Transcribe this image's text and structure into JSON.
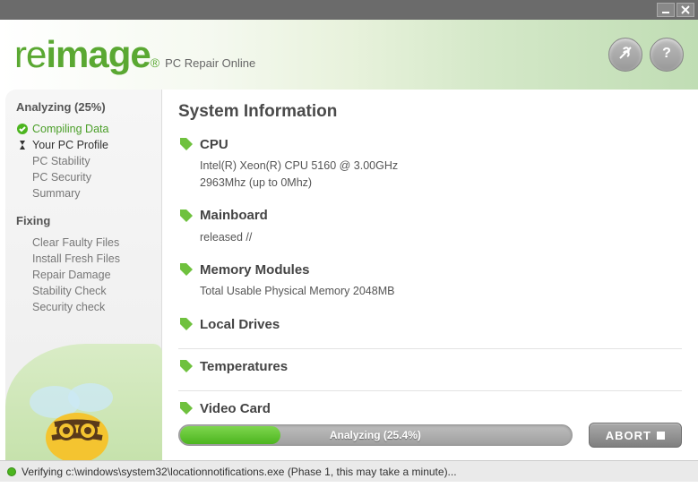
{
  "title_bar": {},
  "header": {
    "logo_prefix": "re",
    "logo_suffix": "image",
    "registered": "®",
    "tagline": "PC Repair Online"
  },
  "sidebar": {
    "analyzing_heading": "Analyzing (25%)",
    "analyzing_items": [
      {
        "label": "Compiling Data",
        "status": "done"
      },
      {
        "label": "Your PC Profile",
        "status": "active"
      },
      {
        "label": "PC Stability",
        "status": "pending"
      },
      {
        "label": "PC Security",
        "status": "pending"
      },
      {
        "label": "Summary",
        "status": "pending"
      }
    ],
    "fixing_heading": "Fixing",
    "fixing_items": [
      {
        "label": "Clear Faulty Files"
      },
      {
        "label": "Install Fresh Files"
      },
      {
        "label": "Repair Damage"
      },
      {
        "label": "Stability Check"
      },
      {
        "label": "Security check"
      }
    ]
  },
  "main": {
    "title": "System Information",
    "sections": {
      "cpu": {
        "heading": "CPU",
        "line1": "Intel(R) Xeon(R) CPU 5160 @ 3.00GHz",
        "line2": "2963Mhz (up to 0Mhz)"
      },
      "mainboard": {
        "heading": "Mainboard",
        "line1": "released //"
      },
      "memory": {
        "heading": "Memory Modules",
        "line1": "Total Usable Physical Memory 2048MB"
      },
      "local_drives": {
        "heading": "Local Drives"
      },
      "temperatures": {
        "heading": "Temperatures"
      },
      "video_card": {
        "heading": "Video Card"
      }
    },
    "progress": {
      "percent": 25.4,
      "label": "Analyzing  (25.4%)"
    },
    "abort_label": "ABORT"
  },
  "statusbar": {
    "text": "Verifying c:\\windows\\system32\\locationnotifications.exe (Phase 1, this may take a minute)..."
  }
}
